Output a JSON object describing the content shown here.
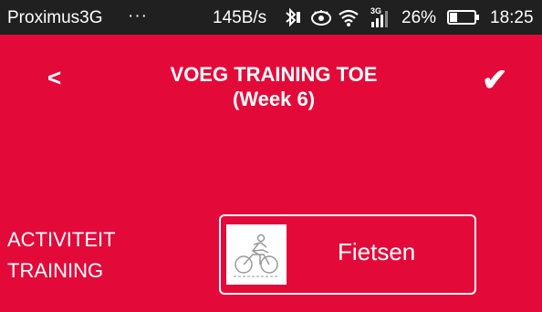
{
  "status_bar": {
    "carrier": "Proximus3G",
    "overflow": "···",
    "network_speed": "145B/s",
    "network_type": "3G",
    "battery_percent": "26%",
    "time": "18:25"
  },
  "header": {
    "back_label": "<",
    "title_line1": "VOEG TRAINING TOE",
    "title_line2": "(Week 6)",
    "confirm_label": "✔"
  },
  "form": {
    "row_label_line1": "ACTIVITEIT",
    "row_label_line2": "TRAINING",
    "activity_value": "Fietsen",
    "activity_icon": "cycling-icon"
  },
  "colors": {
    "background": "#e30a3a",
    "status_bar": "#202020",
    "text": "#ffffff"
  }
}
